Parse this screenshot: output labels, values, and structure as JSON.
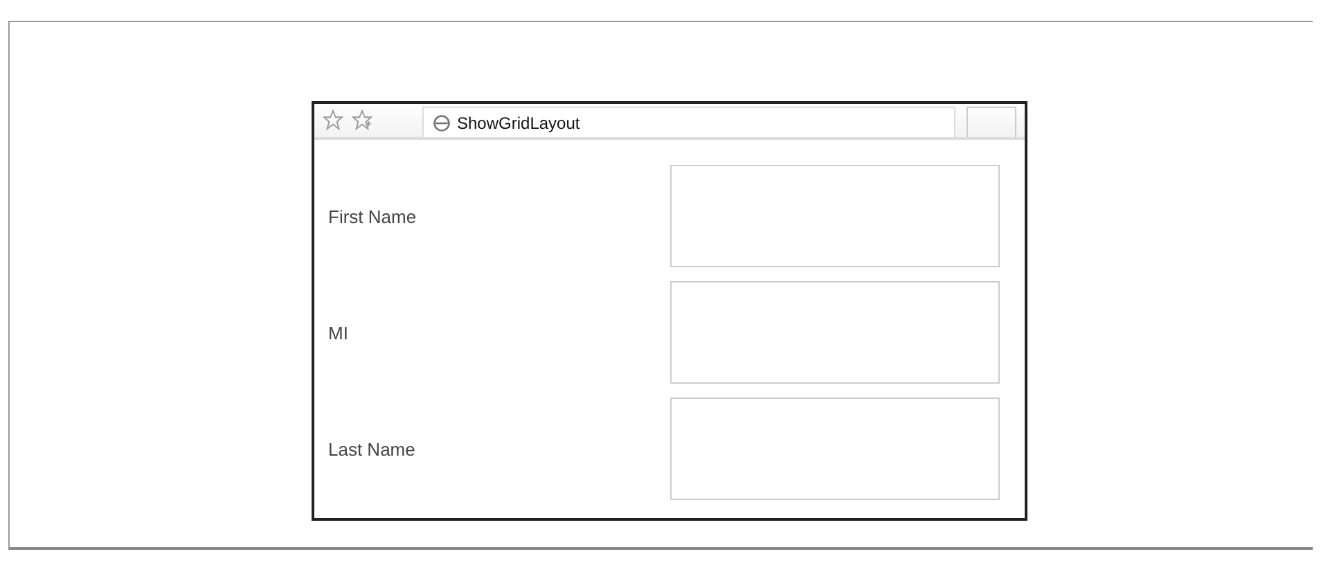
{
  "browser": {
    "tab_title": "ShowGridLayout"
  },
  "form": {
    "rows": [
      {
        "label": "First Name"
      },
      {
        "label": "MI"
      },
      {
        "label": "Last Name"
      }
    ]
  }
}
